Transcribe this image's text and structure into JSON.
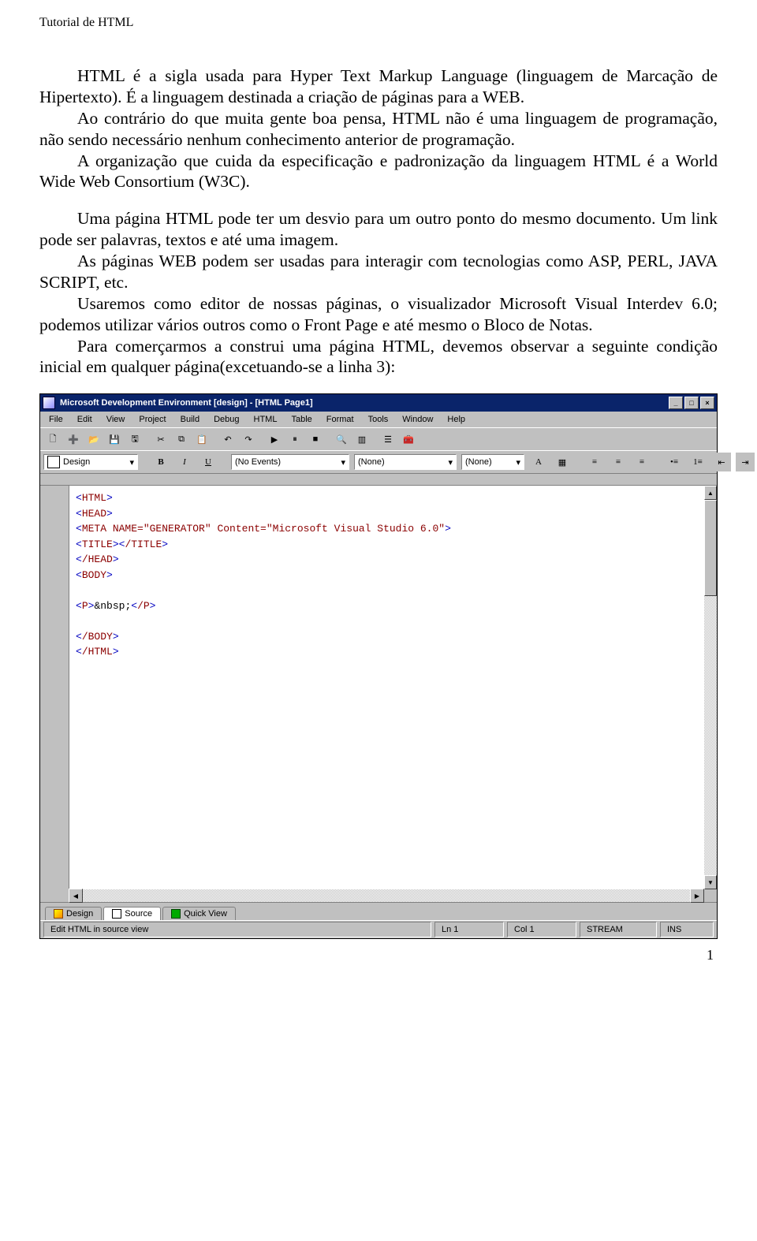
{
  "header": "Tutorial de HTML",
  "page_number": "1",
  "paragraphs": {
    "p1": "HTML é a sigla usada para Hyper Text Markup Language (linguagem de Marcação de Hipertexto). É a linguagem destinada a criação de páginas para a WEB.",
    "p2": "Ao contrário do que muita gente boa pensa, HTML não é uma linguagem de programação, não sendo necessário nenhum conhecimento anterior de programação.",
    "p3": "A organização que cuida da especificação e padronização da linguagem HTML é a World Wide Web Consortium (W3C).",
    "p4": "Uma página HTML pode ter um desvio para um outro ponto do mesmo documento. Um link pode ser palavras, textos e até uma imagem.",
    "p5": "As páginas WEB podem ser usadas para interagir com tecnologias como ASP, PERL, JAVA SCRIPT, etc.",
    "p6": "Usaremos como editor de nossas páginas, o visualizador Microsoft Visual Interdev 6.0; podemos utilizar vários outros como o Front Page e até mesmo o Bloco de Notas.",
    "p7": "Para comerçarmos a construi uma página HTML, devemos observar a seguinte condição inicial em qualquer página(excetuando-se a linha 3):"
  },
  "editor": {
    "titlebar": "Microsoft Development Environment [design] - [HTML Page1]",
    "menus": [
      "File",
      "Edit",
      "View",
      "Project",
      "Build",
      "Debug",
      "HTML",
      "Table",
      "Format",
      "Tools",
      "Window",
      "Help"
    ],
    "toolbar1_icons": [
      "new-project",
      "add-item",
      "open",
      "save",
      "save-all",
      "sep",
      "cut",
      "copy",
      "paste",
      "sep",
      "undo",
      "redo",
      "sep",
      "start",
      "break",
      "stop",
      "sep",
      "find",
      "debug-windows",
      "sep",
      "properties",
      "toolbox"
    ],
    "design_dropdown": "Design",
    "element_dropdown": "(No Events)",
    "font_name": "(None)",
    "font_size": "(None)",
    "tabs": {
      "design": "Design",
      "source": "Source",
      "quick": "Quick View"
    },
    "statusbar": {
      "hint": "Edit HTML in source view",
      "line": "Ln 1",
      "col": "Col 1",
      "mode1": "STREAM",
      "mode2": "INS"
    },
    "code_lines": [
      {
        "raw": "<HTML>"
      },
      {
        "raw": "<HEAD>"
      },
      {
        "raw": "<META NAME=\"GENERATOR\" Content=\"Microsoft Visual Studio 6.0\">"
      },
      {
        "raw": "<TITLE></TITLE>"
      },
      {
        "raw": "</HEAD>"
      },
      {
        "raw": "<BODY>"
      },
      {
        "raw": ""
      },
      {
        "raw": "<P>&nbsp;</P>"
      },
      {
        "raw": ""
      },
      {
        "raw": "</BODY>"
      },
      {
        "raw": "</HTML>"
      }
    ]
  }
}
